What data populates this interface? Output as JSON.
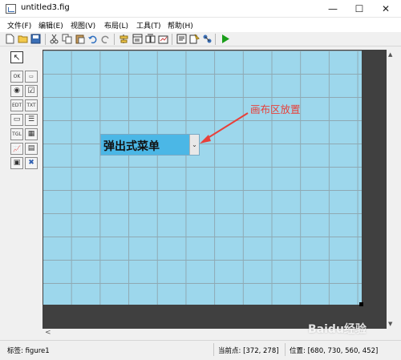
{
  "window": {
    "title": "untitled3.fig",
    "minimize_glyph": "—",
    "maximize_glyph": "☐",
    "close_glyph": "✕"
  },
  "menu": [
    {
      "label": "文件(F)"
    },
    {
      "label": "编辑(E)"
    },
    {
      "label": "视图(V)"
    },
    {
      "label": "布局(L)"
    },
    {
      "label": "工具(T)"
    },
    {
      "label": "帮助(H)"
    }
  ],
  "toolbar": {
    "icons": [
      "new-icon",
      "open-icon",
      "save-icon",
      "cut-icon",
      "copy-icon",
      "paste-icon",
      "undo-icon",
      "redo-icon",
      "align-icon",
      "menu-editor-icon",
      "tab-order-icon",
      "toolbar-editor-icon",
      "mfile-editor-icon",
      "property-inspector-icon",
      "object-browser-icon",
      "run-icon"
    ],
    "colors": {
      "run": "#1a9e1a"
    }
  },
  "palette": {
    "items": [
      {
        "name": "select-tool",
        "glyph": "↖"
      },
      {
        "name": "push-button",
        "glyph": "OK"
      },
      {
        "name": "slider",
        "glyph": "▭"
      },
      {
        "name": "radio-button",
        "glyph": "◉"
      },
      {
        "name": "checkbox",
        "glyph": "☑"
      },
      {
        "name": "edit-text",
        "glyph": "EDT"
      },
      {
        "name": "static-text",
        "glyph": "TXT"
      },
      {
        "name": "popup-menu",
        "glyph": "▭"
      },
      {
        "name": "listbox",
        "glyph": "☰"
      },
      {
        "name": "toggle-button",
        "glyph": "TGL"
      },
      {
        "name": "table",
        "glyph": "▦"
      },
      {
        "name": "axes",
        "glyph": "📈"
      },
      {
        "name": "panel",
        "glyph": "▤"
      },
      {
        "name": "button-group",
        "glyph": "▣"
      },
      {
        "name": "activex-control",
        "glyph": "✖"
      }
    ]
  },
  "canvas": {
    "popup_label": "弹出式菜单",
    "popup_arrow": "⌄",
    "annotation": "画布区放置",
    "colors": {
      "background": "#9dd7ec",
      "popup": "#4bb7e6",
      "annotation": "#e8403a"
    }
  },
  "scroll": {
    "up": "▲",
    "down": "▼",
    "left": "<"
  },
  "status": {
    "tag": "标签: figure1",
    "current_point": "当前点:  [372, 278]",
    "position": "位置: [680, 730, 560, 452]"
  },
  "watermark": "Baidu经验"
}
